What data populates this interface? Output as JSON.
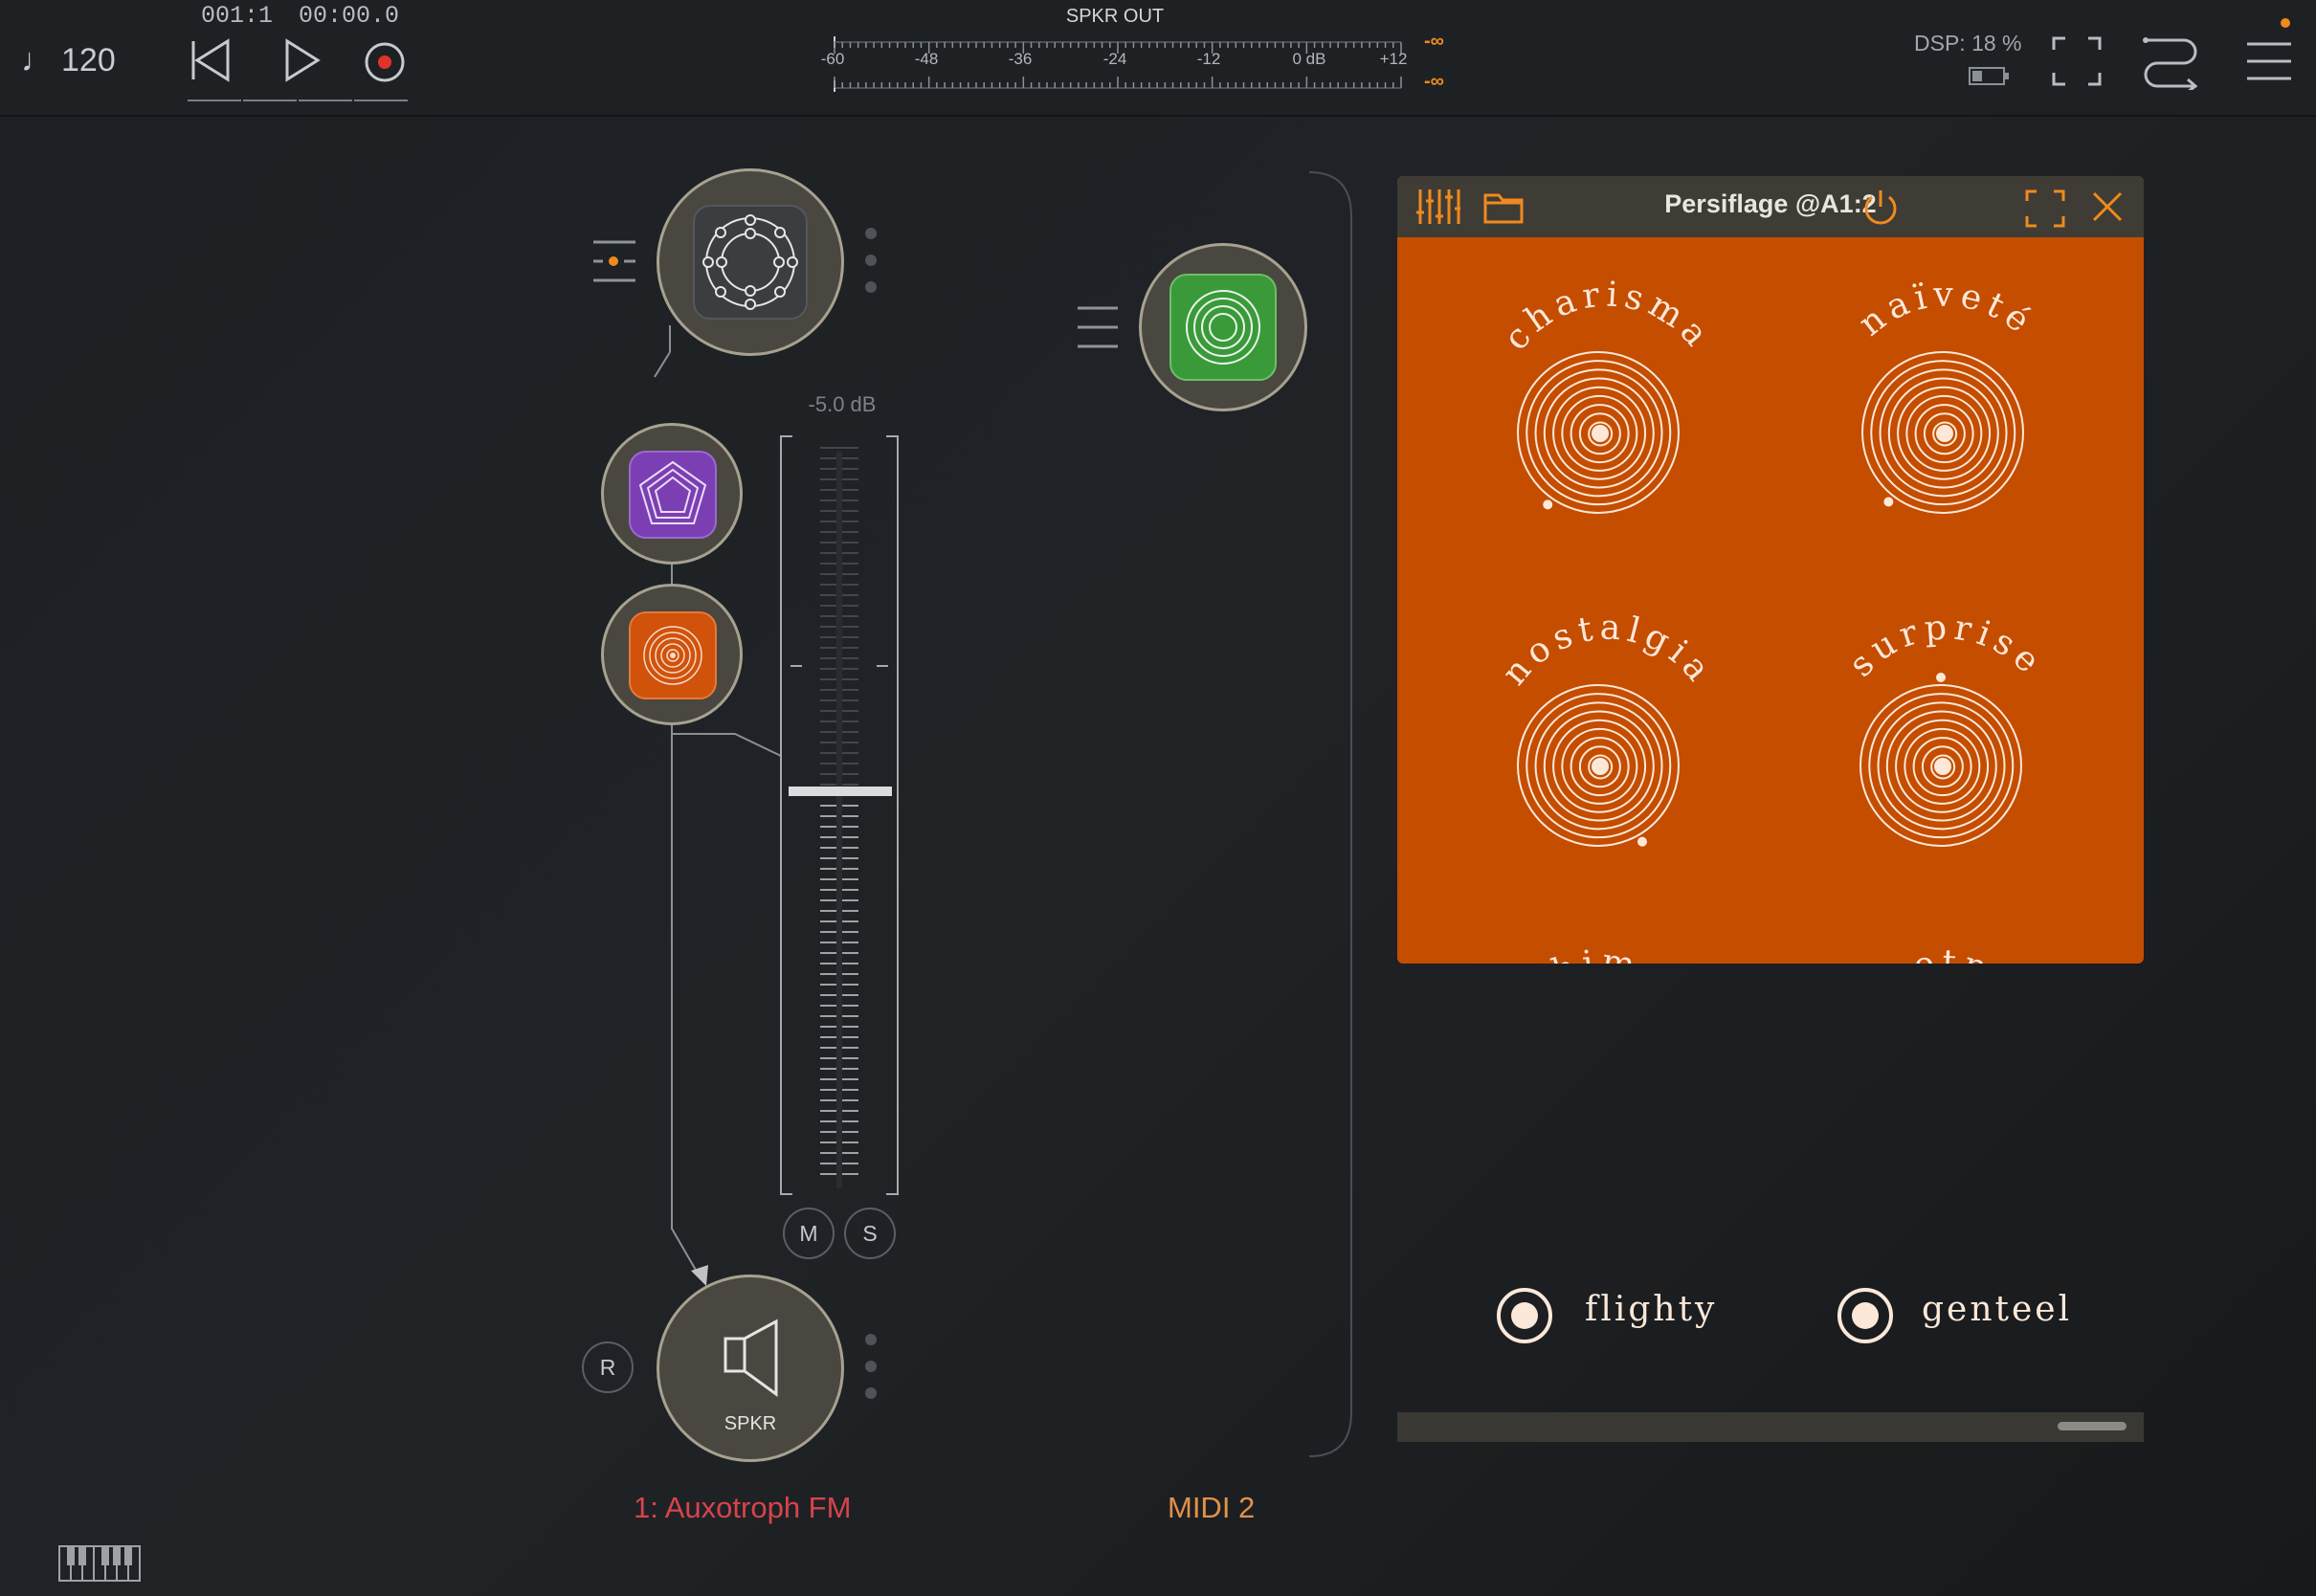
{
  "transport": {
    "tempo": "120",
    "bar_position": "001:1",
    "time_position": "00:00.0"
  },
  "output_meter": {
    "title": "SPKR OUT",
    "scale": [
      "-60",
      "-48",
      "-36",
      "-24",
      "-12",
      "0 dB",
      "+12"
    ],
    "peak_top": "-∞",
    "peak_bottom": "-∞"
  },
  "status": {
    "dsp": "DSP: 18 %"
  },
  "channel_1": {
    "label": "1: Auxotroph FM",
    "fader_db": "-5.0 dB",
    "mute": "M",
    "solo": "S",
    "record": "R",
    "output_node": "SPKR"
  },
  "channel_2": {
    "label": "MIDI 2"
  },
  "plugin": {
    "title": "Persiflage @A1:2",
    "knobs": [
      "charisma",
      "naïveté",
      "nostalgia",
      "surprise",
      "whimsy",
      "sweetness"
    ],
    "radios": [
      {
        "label": "flighty",
        "selected": true
      },
      {
        "label": "genteel",
        "selected": true
      }
    ]
  },
  "colors": {
    "accent": "#f08a1e",
    "plugin_bg": "#c44d00",
    "channel_1_label": "#d8434c",
    "channel_2_label": "#e3914a",
    "node_fill": "#4a4740"
  }
}
